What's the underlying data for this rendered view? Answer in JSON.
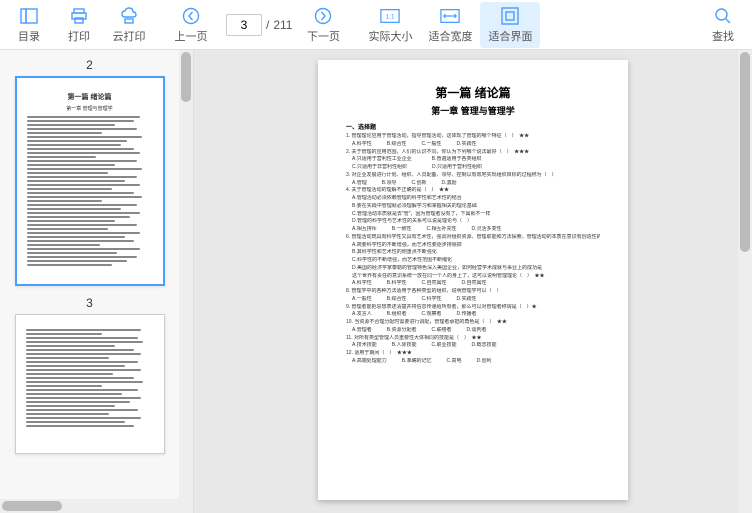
{
  "toolbar": {
    "catalog": "目录",
    "print": "打印",
    "cloud_print": "云打印",
    "prev_page": "上一页",
    "next_page": "下一页",
    "actual_size": "实际大小",
    "fit_width": "适合宽度",
    "fit_page": "适合界面",
    "find": "查找"
  },
  "paging": {
    "current": "3",
    "sep": "/",
    "total": "211"
  },
  "thumbs": {
    "p2_label": "2",
    "p2_title": "第一篇 绪论篇",
    "p2_sub": "第一章 管理与管理学",
    "p3_label": "3"
  },
  "doc": {
    "title": "第一篇 绪论篇",
    "chapter": "第一章 管理与管理学",
    "section": "一、选择题",
    "q1": "1. 管理理论应用于管理活动，指导管理活动，这体现了管理的哪个特征（　）　★★",
    "q1_opts": "A.科学性　　　B.综合性　　　C.一般性　　　D.实践性",
    "q2": "2. 关于管理的应用范围，人们的认识不同，你认为下列哪个说法最好（　）　★★★",
    "q2_opts": "A.只适用于营利性工业企业　　　　B.普遍适用于各类组织",
    "q2_opts2": "C.只适用于非营利性组织　　　　　D.只适用于营利性组织",
    "q3": "3. 对企业发展进行计划、组织、人员配备、领导、控制以有效地实现组织目标的过程称为（　）",
    "q3_opts": "A.管理　　　B.领导　　　C.创新　　　D.激励",
    "q4": "4. 关于管理活动的理解不正确的是（　）　★★",
    "q4_a": "A.管理活动必须依赖管理的科学性和艺术性的结合",
    "q4_b": "B.要在实践中管理就必须理解学习和掌握相关的理论基础",
    "q4_c": "C.管理活动本质就是去\"管\"，因为管理者没有了，下属就不一样",
    "q4_d": "D.管理的科学性与艺术性的关系可以说是理论与（　）",
    "q4_opts": "A.相互排斥　　　B.一致性　　　C.相互补充性　　　D.灵活多变性",
    "q6": "6. 管理活动既具有科学性又具有艺术性，强调对组织资源、管理职能和方法探索，管理活动的本质在意识有创造性的应用，因为大量的事实证明，其管理活动主要以下变化（　）",
    "q6_a": "A.简要科学性的不断增强，而艺术性要逐步排除掉",
    "q6_b": "B.其科学性和艺术性的侧重点不断强化",
    "q6_c": "C.科学性的不断增强，而艺术性范围不断缩化",
    "q6_d": "D.美国的经济学家泰勒的管理特色深入美国企业，如何经营学术成就与事业上的成功是",
    "q6_e": "这个世界有责任的意识系统一放在同一个人的身上了，这可以说明管理理论（　）　★★",
    "q6_opts": "A.科学性　　　B.科学性　　　C.自然属性　　　D.自然属性",
    "q7": "8. 管理学中的各种方法适用于各种类型的组织，说明管理学可以（　）",
    "q7_opts": "A.一般性　　　B.综合性　　　C.科学性　　　D.实践性",
    "q8": "9. 管理者能把思想表述清楚并将信息传递给所有者，那么可以对管理者称谓是（　）★",
    "q8_opts": "A.发言人　　　B.组织者　　　C.观察者　　　D.传播者",
    "q9": "10. 当资源不合理分配时需要进行调配，管理者承担的角色是（　）　★★",
    "q9_opts": "A.管理者　　　B.资源分配者　　　C.联络者　　　D.谈判者",
    "q10": "11. 对所有类型管理人员重要性大体相同的技能是（　）　★★",
    "q10_opts": "A.技术技能　　　B.人际技能　　　C.职业技能　　　D.概念技能",
    "q11": "12. 适用于期间（　）　★★★",
    "q11_opts": "A.高端处理能力　　　B.准确的记忆　　　C.高电　　　D.创利"
  }
}
